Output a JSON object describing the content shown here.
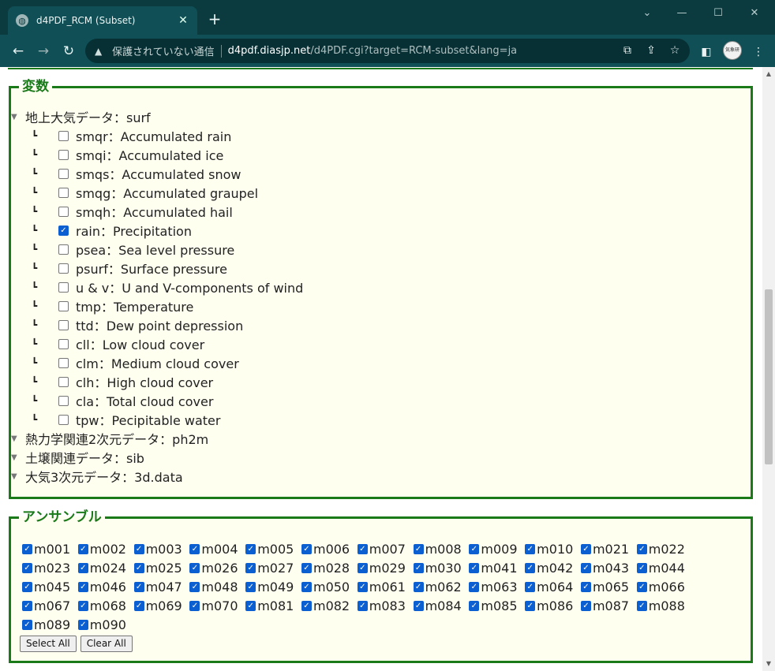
{
  "browser": {
    "tab_title": "d4PDF_RCM (Subset)",
    "new_tab": "+",
    "security_label": "保護されていない通信",
    "url_domain": "d4pdf.diasjp.net",
    "url_path": "/d4PDF.cgi?target=RCM-subset&lang=ja",
    "avatar_text": "気象研究所"
  },
  "variables": {
    "legend": "変数",
    "groups": [
      {
        "label": "地上大気データ：surf"
      },
      {
        "label": "熱力学関連2次元データ：ph2m"
      },
      {
        "label": "土壌関連データ：sib"
      },
      {
        "label": "大気3次元データ：3d.data"
      }
    ],
    "items": [
      {
        "label": "smqr：Accumulated rain",
        "checked": false
      },
      {
        "label": "smqi：Accumulated ice",
        "checked": false
      },
      {
        "label": "smqs：Accumulated snow",
        "checked": false
      },
      {
        "label": "smqg：Accumulated graupel",
        "checked": false
      },
      {
        "label": "smqh：Accumulated hail",
        "checked": false
      },
      {
        "label": "rain：Precipitation",
        "checked": true
      },
      {
        "label": "psea：Sea level pressure",
        "checked": false
      },
      {
        "label": "psurf：Surface pressure",
        "checked": false
      },
      {
        "label": "u & v：U and V-components of wind",
        "checked": false
      },
      {
        "label": "tmp：Temperature",
        "checked": false
      },
      {
        "label": "ttd：Dew point depression",
        "checked": false
      },
      {
        "label": "cll：Low cloud cover",
        "checked": false
      },
      {
        "label": "clm：Medium cloud cover",
        "checked": false
      },
      {
        "label": "clh：High cloud cover",
        "checked": false
      },
      {
        "label": "cla：Total cloud cover",
        "checked": false
      },
      {
        "label": "tpw：Pecipitable water",
        "checked": false
      }
    ]
  },
  "ensemble": {
    "legend": "アンサンブル",
    "members": [
      "m001",
      "m002",
      "m003",
      "m004",
      "m005",
      "m006",
      "m007",
      "m008",
      "m009",
      "m010",
      "m021",
      "m022",
      "m023",
      "m024",
      "m025",
      "m026",
      "m027",
      "m028",
      "m029",
      "m030",
      "m041",
      "m042",
      "m043",
      "m044",
      "m045",
      "m046",
      "m047",
      "m048",
      "m049",
      "m050",
      "m061",
      "m062",
      "m063",
      "m064",
      "m065",
      "m066",
      "m067",
      "m068",
      "m069",
      "m070",
      "m081",
      "m082",
      "m083",
      "m084",
      "m085",
      "m086",
      "m087",
      "m088",
      "m089",
      "m090"
    ],
    "select_all": "Select All",
    "clear_all": "Clear All"
  }
}
